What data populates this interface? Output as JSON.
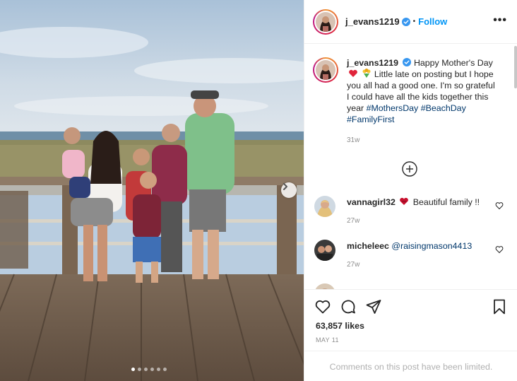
{
  "post": {
    "username": "j_evans1219",
    "follow_label": "Follow",
    "separator": "•",
    "more_label": "•••"
  },
  "caption": {
    "username": "j_evans1219",
    "text_1": "Happy Mother's Day",
    "text_2": "Little late on posting but I hope you all had a good one. I'm so grateful I could have all the kids together this year",
    "hashtags": [
      "#MothersDay",
      "#BeachDay",
      "#FamilyFirst"
    ],
    "time": "31w"
  },
  "comments": [
    {
      "username": "vannagirl32",
      "text": "Beautiful family !!",
      "time": "27w"
    },
    {
      "username": "micheleec",
      "mention": "@raisingmason4413",
      "time": "27w"
    }
  ],
  "stats": {
    "likes": "63,857 likes",
    "date": "MAY 11"
  },
  "footer": {
    "limited_text": "Comments on this post have been limited."
  },
  "carousel": {
    "slide_count": 6,
    "active_index": 0
  },
  "colors": {
    "link": "#0095f6",
    "hashtag": "#00376b",
    "muted": "#8e8e8e",
    "verified": "#3897f0"
  }
}
